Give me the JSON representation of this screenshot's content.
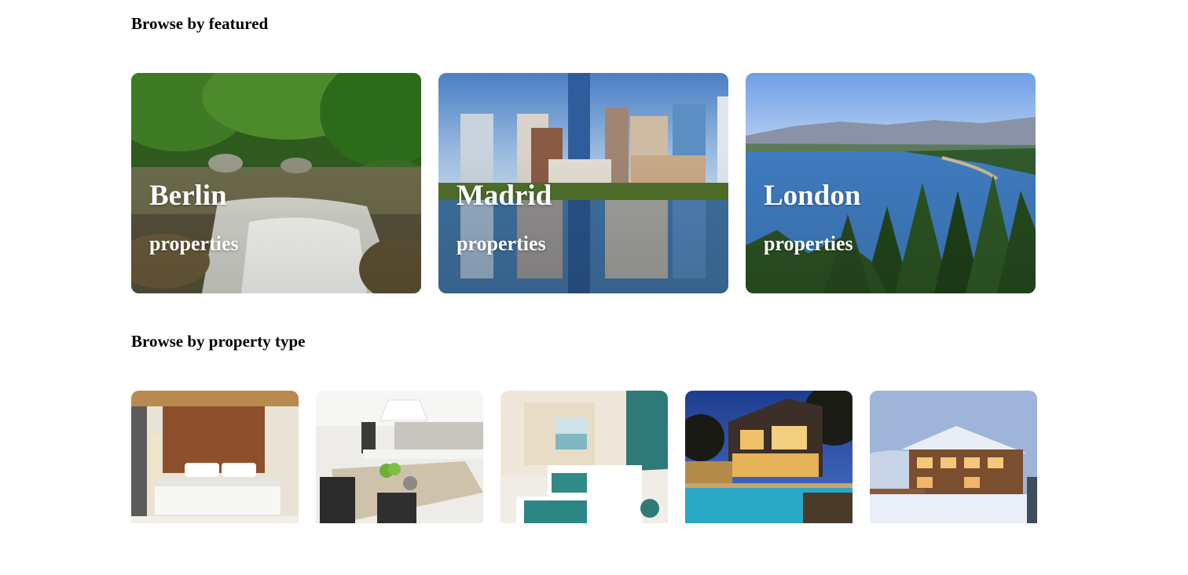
{
  "featured": {
    "title": "Browse by featured",
    "cards": [
      {
        "city": "Berlin",
        "label": "properties",
        "image": "forest-waterfall-image"
      },
      {
        "city": "Madrid",
        "label": "properties",
        "image": "city-skyline-lake-image"
      },
      {
        "city": "London",
        "label": "properties",
        "image": "lake-mountains-forest-image"
      }
    ]
  },
  "property_types": {
    "title": "Browse by property type",
    "cards": [
      {
        "image": "hotel-bedroom-image"
      },
      {
        "image": "apartment-kitchen-image"
      },
      {
        "image": "resort-room-image"
      },
      {
        "image": "villa-pool-image"
      },
      {
        "image": "snowy-cabin-image"
      }
    ]
  }
}
